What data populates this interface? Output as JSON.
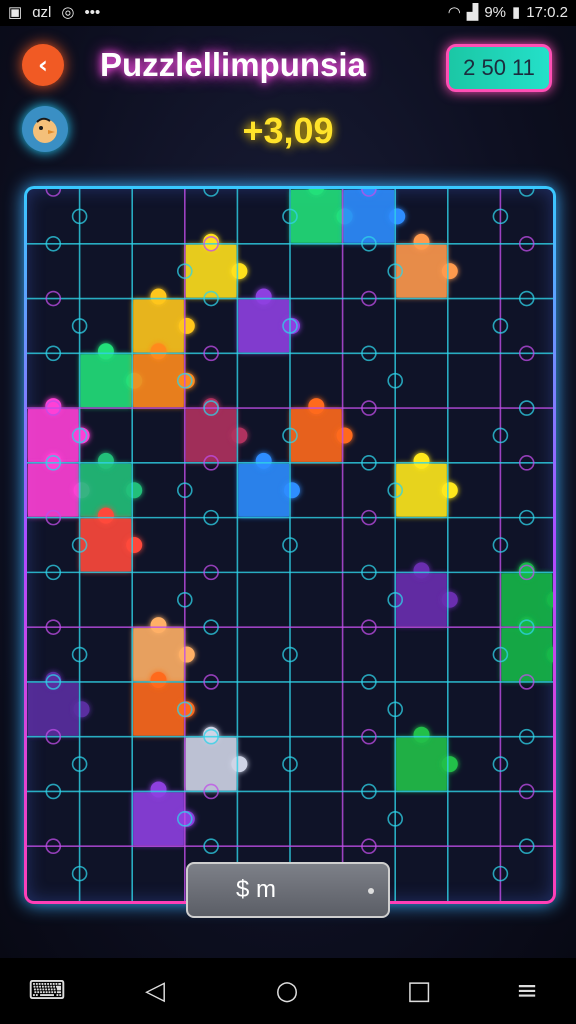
{
  "status_bar": {
    "left_text": "ɑzl",
    "right_text": "9%",
    "time": "17:0.2"
  },
  "header": {
    "title": "Puzzlellimpunsia",
    "score_chip": "2 50 11",
    "coins": "+3,09"
  },
  "hint": {
    "label": "$ m"
  },
  "colors": {
    "grid_line": "#2fd3e8",
    "grid_line_alt": "#c04ee8",
    "pieces": [
      "#ff3fb6",
      "#ffe01a",
      "#ff6b1f",
      "#23e07a",
      "#2d8dff",
      "#8e3fe0",
      "#ff3b3b"
    ]
  },
  "board": {
    "cols": 10,
    "rows": 13,
    "pieces": [
      {
        "col": 5,
        "row": 0,
        "color": "#23e07a"
      },
      {
        "col": 6,
        "row": 0,
        "color": "#2d8dff"
      },
      {
        "col": 3,
        "row": 1,
        "color": "#ffe01a"
      },
      {
        "col": 7,
        "row": 1,
        "color": "#ff9a4d"
      },
      {
        "col": 2,
        "row": 2,
        "color": "#ffc61a"
      },
      {
        "col": 4,
        "row": 2,
        "color": "#8e3fe0"
      },
      {
        "col": 1,
        "row": 3,
        "color": "#23e07a"
      },
      {
        "col": 2,
        "row": 3,
        "color": "#ff8a1f"
      },
      {
        "col": 0,
        "row": 4,
        "color": "#ff3fd6"
      },
      {
        "col": 3,
        "row": 4,
        "color": "#b0305f"
      },
      {
        "col": 5,
        "row": 4,
        "color": "#ff6b1f"
      },
      {
        "col": 0,
        "row": 5,
        "color": "#ff3fd6"
      },
      {
        "col": 1,
        "row": 5,
        "color": "#23c07a"
      },
      {
        "col": 4,
        "row": 5,
        "color": "#2d8dff"
      },
      {
        "col": 7,
        "row": 5,
        "color": "#ffe81a"
      },
      {
        "col": 1,
        "row": 6,
        "color": "#ff4a3b"
      },
      {
        "col": 9,
        "row": 7,
        "color": "#18b84a"
      },
      {
        "col": 2,
        "row": 8,
        "color": "#ffb066"
      },
      {
        "col": 9,
        "row": 8,
        "color": "#18b84a"
      },
      {
        "col": 2,
        "row": 9,
        "color": "#ff6b1f"
      },
      {
        "col": 3,
        "row": 10,
        "color": "#cfd4e6"
      },
      {
        "col": 7,
        "row": 10,
        "color": "#23c04a"
      },
      {
        "col": 2,
        "row": 11,
        "color": "#8e3fe0"
      },
      {
        "col": 0,
        "row": 9,
        "color": "#5a2fa0"
      },
      {
        "col": 7,
        "row": 7,
        "color": "#6a2fb0"
      }
    ]
  }
}
